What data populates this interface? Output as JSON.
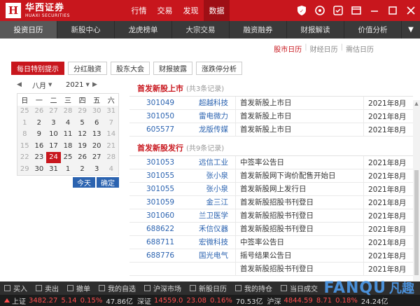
{
  "app": {
    "name_cn": "华西证券",
    "name_en": "HUAXI SECURITIES"
  },
  "topnav": [
    "行情",
    "交易",
    "发现",
    "数据"
  ],
  "topnav_active": 3,
  "secbar": [
    "投资日历",
    "新股中心",
    "龙虎榜单",
    "大宗交易",
    "融资融券",
    "财报解读",
    "价值分析"
  ],
  "calswitch": [
    "股市日历",
    "财经日历",
    "需估日历"
  ],
  "tabs": [
    "每日特别提示",
    "分红融资",
    "股东大会",
    "财报披露",
    "涨跌停分析"
  ],
  "calendar": {
    "month": "八月",
    "year": "2021",
    "weekdays": [
      "日",
      "一",
      "二",
      "三",
      "四",
      "五",
      "六"
    ],
    "weeks": [
      [
        "25",
        "26",
        "27",
        "28",
        "29",
        "30",
        "31"
      ],
      [
        "1",
        "2",
        "3",
        "4",
        "5",
        "6",
        "7"
      ],
      [
        "8",
        "9",
        "10",
        "11",
        "12",
        "13",
        "14"
      ],
      [
        "15",
        "16",
        "17",
        "18",
        "19",
        "20",
        "21"
      ],
      [
        "22",
        "23",
        "24",
        "25",
        "26",
        "27",
        "28"
      ],
      [
        "29",
        "30",
        "31",
        "1",
        "2",
        "3",
        "4"
      ]
    ],
    "today_btn": "今天",
    "ok_btn": "确定"
  },
  "section1": {
    "title": "首发新股上市",
    "count": "(共3条记录)",
    "rows": [
      {
        "code": "301049",
        "name": "超越科技",
        "event": "首发新股上市日",
        "date": "2021年8月"
      },
      {
        "code": "301050",
        "name": "雷电微力",
        "event": "首发新股上市日",
        "date": "2021年8月"
      },
      {
        "code": "605577",
        "name": "龙版传媒",
        "event": "首发新股上市日",
        "date": "2021年8月"
      }
    ]
  },
  "section2": {
    "title": "首发新股发行",
    "count": "(共9条记录)",
    "rows": [
      {
        "code": "301053",
        "name": "远信工业",
        "event": "中签率公告日",
        "date": "2021年8月"
      },
      {
        "code": "301055",
        "name": "张小泉",
        "event": "首发新股网下询价配售开始日",
        "date": "2021年8月"
      },
      {
        "code": "301055",
        "name": "张小泉",
        "event": "首发新股网上发行日",
        "date": "2021年8月"
      },
      {
        "code": "301059",
        "name": "金三江",
        "event": "首发新股招股书刊登日",
        "date": "2021年8月"
      },
      {
        "code": "301060",
        "name": "兰卫医学",
        "event": "首发新股招股书刊登日",
        "date": "2021年8月"
      },
      {
        "code": "688622",
        "name": "禾信仪器",
        "event": "首发新股招股书刊登日",
        "date": "2021年8月"
      },
      {
        "code": "688711",
        "name": "宏微科技",
        "event": "中签率公告日",
        "date": "2021年8月"
      },
      {
        "code": "688776",
        "name": "国光电气",
        "event": "摇号结果公告日",
        "date": "2021年8月"
      },
      {
        "code": "",
        "name": "",
        "event": "首发新股招股书刊登日",
        "date": "2021年8月"
      }
    ]
  },
  "botbar": [
    "买入",
    "卖出",
    "撤单",
    "我的自选",
    "沪深市场",
    "新股日历",
    "我的持仓",
    "当日成交"
  ],
  "ticker": [
    {
      "label": "上证",
      "price": "3482.27",
      "chg": "5.14",
      "pct": "0.15%",
      "amt": "47.86亿"
    },
    {
      "label": "深证",
      "price": "14559.0",
      "chg": "23.08",
      "pct": "0.16%",
      "amt": "70.53亿"
    },
    {
      "label": "沪深",
      "price": "4844.59",
      "chg": "8.71",
      "pct": "0.18%",
      "amt": "24.24亿"
    }
  ],
  "watermark": {
    "text": "FANQU",
    "cn": "凡趣"
  },
  "colors": {
    "brand": "#c8161d",
    "link": "#2b63b0",
    "dark_bar": "#3a3a3a"
  }
}
